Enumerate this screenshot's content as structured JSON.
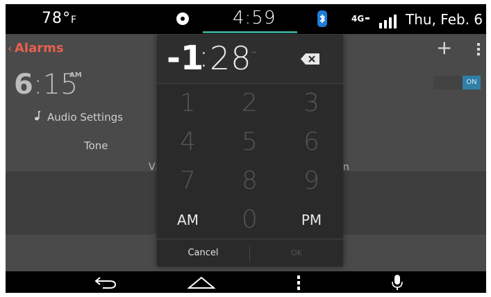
{
  "statusbar": {
    "temp_value": "78°",
    "temp_unit": "F",
    "time": "4:59",
    "date": "Thu, Feb. 6"
  },
  "appbar": {
    "back_glyph": "‹",
    "title": "Alarms",
    "add_glyph": "+"
  },
  "alarm": {
    "hour": "6",
    "minute": ":15",
    "ampm": "AM",
    "toggle_label": "ON",
    "audio_settings_label": "Audio Settings",
    "tone_label": "Tone",
    "volume_left_partial": "V",
    "volume_right_partial": "n"
  },
  "time_picker": {
    "hour": "-1",
    "colon": ":",
    "minute": "28",
    "minute_tick": "‥",
    "keys": [
      "1",
      "2",
      "3",
      "4",
      "5",
      "6",
      "7",
      "8",
      "9"
    ],
    "am_label": "AM",
    "zero_label": "0",
    "pm_label": "PM",
    "cancel_label": "Cancel",
    "ok_label": "OK"
  },
  "icons": {
    "media": "disc-icon",
    "bluetooth": "bluetooth-icon",
    "network": "4g-signal-icon",
    "backspace": "backspace-icon",
    "back": "back-arrow-icon",
    "home": "home-icon",
    "menu": "menu-dots-icon",
    "mic": "microphone-icon"
  },
  "colors": {
    "accent": "#e6604f",
    "toggle_on": "#2f7fa6",
    "time_underline": "#3fb8a6"
  }
}
